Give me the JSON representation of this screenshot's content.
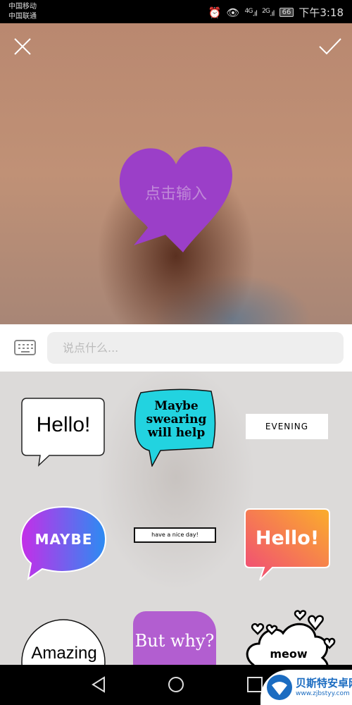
{
  "status_bar": {
    "carrier1": "中国移动",
    "carrier2": "中国联通",
    "signal1": "4G",
    "signal2": "2G",
    "battery": "66",
    "time": "下午3:18",
    "icons": [
      "alarm-icon",
      "eye-icon",
      "signal-icon",
      "battery-icon"
    ]
  },
  "editor": {
    "close_icon": "close-icon",
    "confirm_icon": "check-icon",
    "bubble_text": "点击输入",
    "bubble_color": "#9b3fc8"
  },
  "input": {
    "placeholder": "说点什么...",
    "keyboard_icon": "keyboard-icon"
  },
  "stickers": [
    {
      "text": "Hello!"
    },
    {
      "text": "Maybe swearing will help",
      "line1": "Maybe",
      "line2": "swearing",
      "line3": "will help"
    },
    {
      "text": "EVENING"
    },
    {
      "text": "MAYBE"
    },
    {
      "text": "have a nice day!"
    },
    {
      "text": "Hello!"
    },
    {
      "text": "Amazing"
    },
    {
      "text": "But why?"
    },
    {
      "text": "meow"
    }
  ],
  "watermark": {
    "title": "贝斯特安卓网",
    "url": "www.zjbstyy.com"
  }
}
